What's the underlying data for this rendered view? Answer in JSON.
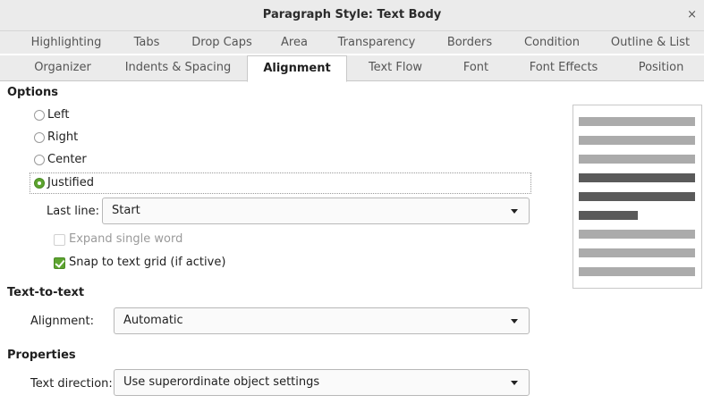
{
  "window": {
    "title": "Paragraph Style: Text Body",
    "close_glyph": "×"
  },
  "tabs_row1": [
    {
      "label": "Highlighting"
    },
    {
      "label": "Tabs"
    },
    {
      "label": "Drop Caps"
    },
    {
      "label": "Area"
    },
    {
      "label": "Transparency"
    },
    {
      "label": "Borders"
    },
    {
      "label": "Condition"
    },
    {
      "label": "Outline & List"
    }
  ],
  "tabs_row2": [
    {
      "label": "Organizer"
    },
    {
      "label": "Indents & Spacing"
    },
    {
      "label": "Alignment",
      "active": true
    },
    {
      "label": "Text Flow"
    },
    {
      "label": "Font"
    },
    {
      "label": "Font Effects"
    },
    {
      "label": "Position"
    }
  ],
  "options": {
    "heading": "Options",
    "radios": [
      {
        "label": "Left",
        "selected": false
      },
      {
        "label": "Right",
        "selected": false
      },
      {
        "label": "Center",
        "selected": false
      },
      {
        "label": "Justified",
        "selected": true
      }
    ],
    "last_line_label": "Last line:",
    "last_line_value": "Start",
    "expand_single_word": {
      "label": "Expand single word",
      "checked": false,
      "enabled": false
    },
    "snap_to_grid": {
      "label": "Snap to text grid (if active)",
      "checked": true,
      "enabled": true
    }
  },
  "text_to_text": {
    "heading": "Text-to-text",
    "alignment_label": "Alignment:",
    "alignment_value": "Automatic"
  },
  "properties": {
    "heading": "Properties",
    "text_direction_label": "Text direction:",
    "text_direction_value": "Use superordinate object settings"
  },
  "colors": {
    "accent": "#5da430",
    "preview_light": "#ababab",
    "preview_dark": "#5a5a5a"
  }
}
